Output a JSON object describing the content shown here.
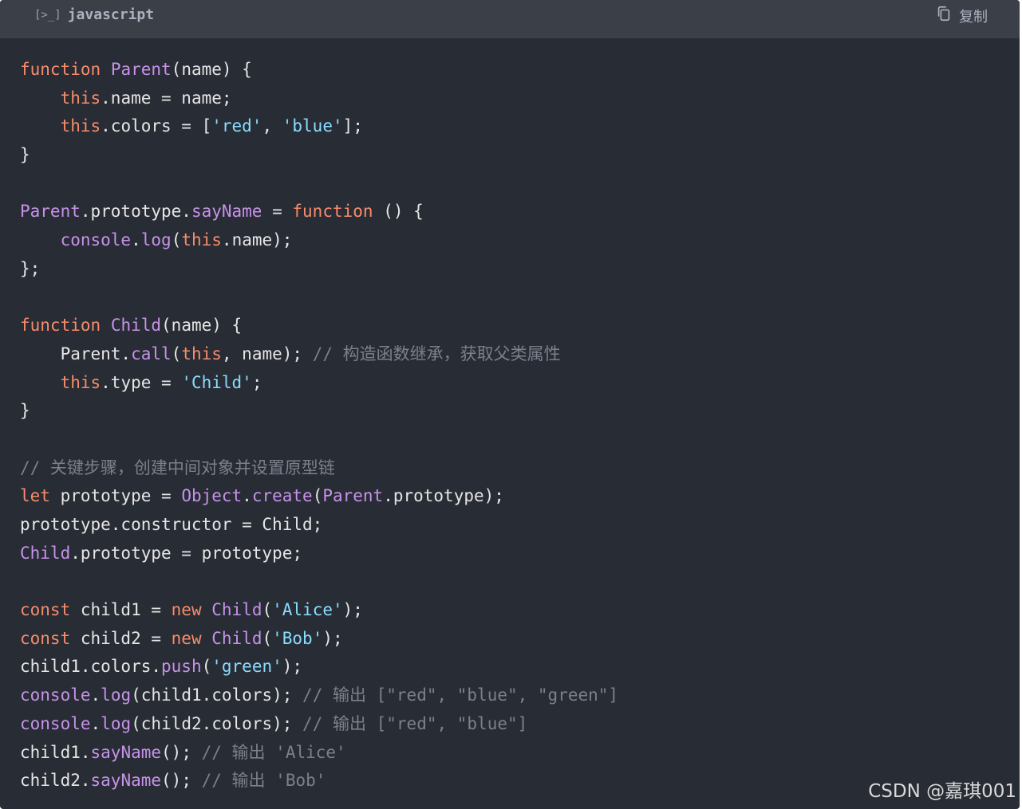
{
  "header": {
    "language": "javascript",
    "copy_label": "复制"
  },
  "code_lines": [
    [
      {
        "t": "function",
        "c": "kw"
      },
      {
        "t": " "
      },
      {
        "t": "Parent",
        "c": "fn"
      },
      {
        "t": "(name) {"
      }
    ],
    [
      {
        "t": "    "
      },
      {
        "t": "this",
        "c": "kw"
      },
      {
        "t": ".name = name;"
      }
    ],
    [
      {
        "t": "    "
      },
      {
        "t": "this",
        "c": "kw"
      },
      {
        "t": ".colors = ["
      },
      {
        "t": "'red'",
        "c": "st"
      },
      {
        "t": ", "
      },
      {
        "t": "'blue'",
        "c": "st"
      },
      {
        "t": "];"
      }
    ],
    [
      {
        "t": "}"
      }
    ],
    [
      {
        "t": ""
      }
    ],
    [
      {
        "t": "Parent",
        "c": "fn"
      },
      {
        "t": ".prototype."
      },
      {
        "t": "sayName",
        "c": "fn"
      },
      {
        "t": " = "
      },
      {
        "t": "function",
        "c": "kw"
      },
      {
        "t": " () {"
      }
    ],
    [
      {
        "t": "    "
      },
      {
        "t": "console",
        "c": "fn"
      },
      {
        "t": "."
      },
      {
        "t": "log",
        "c": "fn"
      },
      {
        "t": "("
      },
      {
        "t": "this",
        "c": "kw"
      },
      {
        "t": ".name);"
      }
    ],
    [
      {
        "t": "};"
      }
    ],
    [
      {
        "t": ""
      }
    ],
    [
      {
        "t": "function",
        "c": "kw"
      },
      {
        "t": " "
      },
      {
        "t": "Child",
        "c": "fn"
      },
      {
        "t": "(name) {"
      }
    ],
    [
      {
        "t": "    Parent."
      },
      {
        "t": "call",
        "c": "fn"
      },
      {
        "t": "("
      },
      {
        "t": "this",
        "c": "kw"
      },
      {
        "t": ", name); "
      },
      {
        "t": "// 构造函数继承，获取父类属性",
        "c": "cm"
      }
    ],
    [
      {
        "t": "    "
      },
      {
        "t": "this",
        "c": "kw"
      },
      {
        "t": ".type = "
      },
      {
        "t": "'Child'",
        "c": "st"
      },
      {
        "t": ";"
      }
    ],
    [
      {
        "t": "}"
      }
    ],
    [
      {
        "t": ""
      }
    ],
    [
      {
        "t": "// 关键步骤，创建中间对象并设置原型链",
        "c": "cm"
      }
    ],
    [
      {
        "t": "let",
        "c": "kw"
      },
      {
        "t": " prototype = "
      },
      {
        "t": "Object",
        "c": "fn"
      },
      {
        "t": "."
      },
      {
        "t": "create",
        "c": "fn"
      },
      {
        "t": "("
      },
      {
        "t": "Parent",
        "c": "fn"
      },
      {
        "t": ".prototype);"
      }
    ],
    [
      {
        "t": "prototype.constructor = Child;"
      }
    ],
    [
      {
        "t": "Child",
        "c": "fn"
      },
      {
        "t": ".prototype = prototype;"
      }
    ],
    [
      {
        "t": ""
      }
    ],
    [
      {
        "t": "const",
        "c": "kw"
      },
      {
        "t": " child1 = "
      },
      {
        "t": "new",
        "c": "kw"
      },
      {
        "t": " "
      },
      {
        "t": "Child",
        "c": "fn"
      },
      {
        "t": "("
      },
      {
        "t": "'Alice'",
        "c": "st"
      },
      {
        "t": ");"
      }
    ],
    [
      {
        "t": "const",
        "c": "kw"
      },
      {
        "t": " child2 = "
      },
      {
        "t": "new",
        "c": "kw"
      },
      {
        "t": " "
      },
      {
        "t": "Child",
        "c": "fn"
      },
      {
        "t": "("
      },
      {
        "t": "'Bob'",
        "c": "st"
      },
      {
        "t": ");"
      }
    ],
    [
      {
        "t": "child1.colors."
      },
      {
        "t": "push",
        "c": "fn"
      },
      {
        "t": "("
      },
      {
        "t": "'green'",
        "c": "st"
      },
      {
        "t": ");"
      }
    ],
    [
      {
        "t": "console",
        "c": "fn"
      },
      {
        "t": "."
      },
      {
        "t": "log",
        "c": "fn"
      },
      {
        "t": "(child1.colors); "
      },
      {
        "t": "// 输出 [\"red\", \"blue\", \"green\"]",
        "c": "cm"
      }
    ],
    [
      {
        "t": "console",
        "c": "fn"
      },
      {
        "t": "."
      },
      {
        "t": "log",
        "c": "fn"
      },
      {
        "t": "(child2.colors); "
      },
      {
        "t": "// 输出 [\"red\", \"blue\"]",
        "c": "cm"
      }
    ],
    [
      {
        "t": "child1."
      },
      {
        "t": "sayName",
        "c": "fn"
      },
      {
        "t": "(); "
      },
      {
        "t": "// 输出 'Alice'",
        "c": "cm"
      }
    ],
    [
      {
        "t": "child2."
      },
      {
        "t": "sayName",
        "c": "fn"
      },
      {
        "t": "(); "
      },
      {
        "t": "// 输出 'Bob'",
        "c": "cm"
      }
    ]
  ],
  "watermark": "CSDN @嘉琪001",
  "colors": {
    "background": "#282c34",
    "header": "#3a3f48",
    "keyword": "#f78c6c",
    "function": "#c792ea",
    "string": "#89ddff",
    "comment": "#7a818c"
  },
  "icons": {
    "language": "terminal-icon",
    "copy": "copy-icon"
  }
}
